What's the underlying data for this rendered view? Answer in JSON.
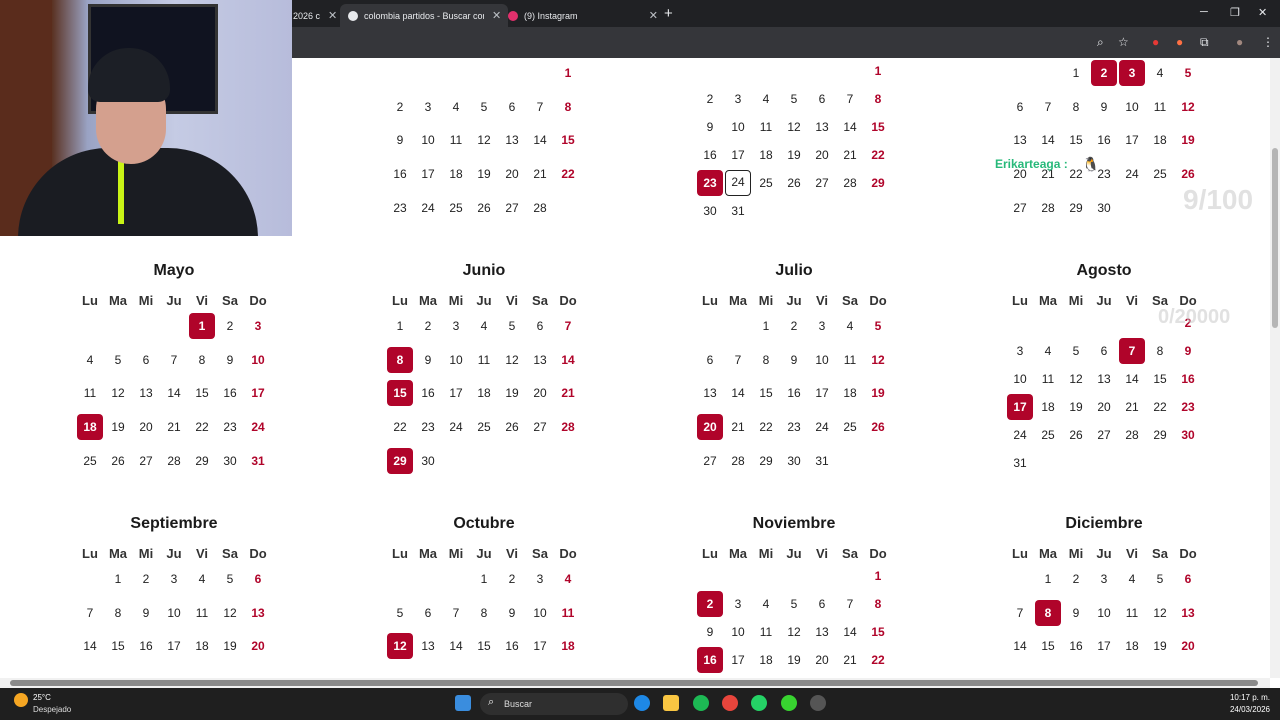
{
  "browser": {
    "tabs": [
      {
        "title": "2026 c",
        "color": "#5f6368"
      },
      {
        "title": "colombia partidos - Buscar con",
        "color": "#e8eaed"
      },
      {
        "title": "(9) Instagram",
        "color": "#e1306c"
      }
    ],
    "new_tab_label": "+",
    "close_glyph": "✕"
  },
  "accent_color": "#b0042a",
  "weekday_headers": [
    "Lu",
    "Ma",
    "Mi",
    "Ju",
    "Vi",
    "Sa",
    "Do"
  ],
  "partial_months": [
    {
      "weeks": [
        [
          "",
          "",
          "",
          "",
          "",
          "",
          "1"
        ],
        [
          "2",
          "3",
          "4",
          "5",
          "6",
          "7",
          "8"
        ],
        [
          "9",
          "10",
          "11",
          "12",
          "13",
          "14",
          "15"
        ],
        [
          "16",
          "17",
          "18",
          "19",
          "20",
          "21",
          "22"
        ],
        [
          "23",
          "24",
          "25",
          "26",
          "27",
          "28",
          ""
        ]
      ],
      "holidays": [],
      "today": ""
    },
    {
      "weeks": [
        [
          "",
          "",
          "",
          "",
          "",
          "",
          "1"
        ],
        [
          "2",
          "3",
          "4",
          "5",
          "6",
          "7",
          "8"
        ],
        [
          "9",
          "10",
          "11",
          "12",
          "13",
          "14",
          "15"
        ],
        [
          "16",
          "17",
          "18",
          "19",
          "20",
          "21",
          "22"
        ],
        [
          "23",
          "24",
          "25",
          "26",
          "27",
          "28",
          "29"
        ],
        [
          "30",
          "31",
          "",
          "",
          "",
          "",
          ""
        ]
      ],
      "holidays": [
        "23"
      ],
      "today": "24"
    },
    {
      "weeks": [
        [
          "",
          "",
          "1",
          "2",
          "3",
          "4",
          "5"
        ],
        [
          "6",
          "7",
          "8",
          "9",
          "10",
          "11",
          "12"
        ],
        [
          "13",
          "14",
          "15",
          "16",
          "17",
          "18",
          "19"
        ],
        [
          "20",
          "21",
          "22",
          "23",
          "24",
          "25",
          "26"
        ],
        [
          "27",
          "28",
          "29",
          "30",
          "",
          "",
          ""
        ]
      ],
      "holidays": [
        "2",
        "3"
      ],
      "today": ""
    }
  ],
  "months": [
    {
      "name": "Mayo",
      "weeks": [
        [
          "",
          "",
          "",
          "",
          "1",
          "2",
          "3"
        ],
        [
          "4",
          "5",
          "6",
          "7",
          "8",
          "9",
          "10"
        ],
        [
          "11",
          "12",
          "13",
          "14",
          "15",
          "16",
          "17"
        ],
        [
          "18",
          "19",
          "20",
          "21",
          "22",
          "23",
          "24"
        ],
        [
          "25",
          "26",
          "27",
          "28",
          "29",
          "30",
          "31"
        ]
      ],
      "holidays": [
        "1",
        "18"
      ]
    },
    {
      "name": "Junio",
      "weeks": [
        [
          "1",
          "2",
          "3",
          "4",
          "5",
          "6",
          "7"
        ],
        [
          "8",
          "9",
          "10",
          "11",
          "12",
          "13",
          "14"
        ],
        [
          "15",
          "16",
          "17",
          "18",
          "19",
          "20",
          "21"
        ],
        [
          "22",
          "23",
          "24",
          "25",
          "26",
          "27",
          "28"
        ],
        [
          "29",
          "30",
          "",
          "",
          "",
          "",
          ""
        ]
      ],
      "holidays": [
        "8",
        "15",
        "29"
      ]
    },
    {
      "name": "Julio",
      "weeks": [
        [
          "",
          "",
          "1",
          "2",
          "3",
          "4",
          "5"
        ],
        [
          "6",
          "7",
          "8",
          "9",
          "10",
          "11",
          "12"
        ],
        [
          "13",
          "14",
          "15",
          "16",
          "17",
          "18",
          "19"
        ],
        [
          "20",
          "21",
          "22",
          "23",
          "24",
          "25",
          "26"
        ],
        [
          "27",
          "28",
          "29",
          "30",
          "31",
          "",
          ""
        ]
      ],
      "holidays": [
        "20"
      ]
    },
    {
      "name": "Agosto",
      "weeks": [
        [
          "",
          "",
          "",
          "",
          "",
          "",
          "2"
        ],
        [
          "3",
          "4",
          "5",
          "6",
          "7",
          "8",
          "9"
        ],
        [
          "10",
          "11",
          "12",
          "13",
          "14",
          "15",
          "16"
        ],
        [
          "17",
          "18",
          "19",
          "20",
          "21",
          "22",
          "23"
        ],
        [
          "24",
          "25",
          "26",
          "27",
          "28",
          "29",
          "30"
        ],
        [
          "31",
          "",
          "",
          "",
          "",
          "",
          ""
        ]
      ],
      "holidays": [
        "7",
        "17"
      ]
    },
    {
      "name": "Septiembre",
      "weeks": [
        [
          "",
          "1",
          "2",
          "3",
          "4",
          "5",
          "6"
        ],
        [
          "7",
          "8",
          "9",
          "10",
          "11",
          "12",
          "13"
        ],
        [
          "14",
          "15",
          "16",
          "17",
          "18",
          "19",
          "20"
        ]
      ],
      "holidays": []
    },
    {
      "name": "Octubre",
      "weeks": [
        [
          "",
          "",
          "",
          "1",
          "2",
          "3",
          "4"
        ],
        [
          "5",
          "6",
          "7",
          "8",
          "9",
          "10",
          "11"
        ],
        [
          "12",
          "13",
          "14",
          "15",
          "16",
          "17",
          "18"
        ]
      ],
      "holidays": [
        "12"
      ]
    },
    {
      "name": "Noviembre",
      "weeks": [
        [
          "",
          "",
          "",
          "",
          "",
          "",
          "1"
        ],
        [
          "2",
          "3",
          "4",
          "5",
          "6",
          "7",
          "8"
        ],
        [
          "9",
          "10",
          "11",
          "12",
          "13",
          "14",
          "15"
        ],
        [
          "16",
          "17",
          "18",
          "19",
          "20",
          "21",
          "22"
        ]
      ],
      "holidays": [
        "2",
        "16"
      ]
    },
    {
      "name": "Diciembre",
      "weeks": [
        [
          "",
          "1",
          "2",
          "3",
          "4",
          "5",
          "6"
        ],
        [
          "7",
          "8",
          "9",
          "10",
          "11",
          "12",
          "13"
        ],
        [
          "14",
          "15",
          "16",
          "17",
          "18",
          "19",
          "20"
        ]
      ],
      "holidays": [
        "8"
      ]
    }
  ],
  "stream_overlay": {
    "username": "Erikarteaga :",
    "counter_top": "9/100",
    "counter_mid": "0/20000"
  },
  "taskbar": {
    "temperature": "25°C",
    "weather": "Despejado",
    "search_placeholder": "Buscar",
    "time": "10:17 p. m.",
    "date": "24/03/2026"
  }
}
